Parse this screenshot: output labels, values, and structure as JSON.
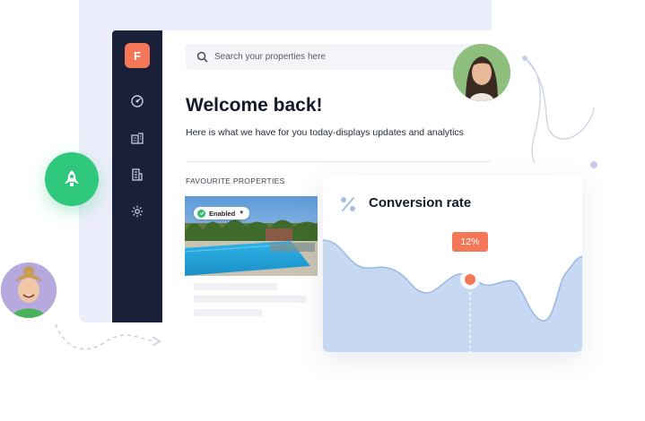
{
  "sidebar": {
    "logo_letter": "F",
    "items": [
      {
        "icon": "gauge-icon"
      },
      {
        "icon": "building-icon"
      },
      {
        "icon": "office-icon"
      },
      {
        "icon": "gear-icon"
      }
    ]
  },
  "search": {
    "placeholder": "Search your properties here"
  },
  "header": {
    "title": "Welcome back!",
    "subtitle": "Here is what we have for you today-displays updates and analytics"
  },
  "favourites": {
    "heading": "FAVOURITE PROPERTIES",
    "card": {
      "status": "Enabled"
    }
  },
  "conversion": {
    "title": "Conversion rate",
    "value_label": "12%"
  },
  "colors": {
    "accent": "#f47757",
    "sidebar": "#1a2037",
    "success": "#2fc87d",
    "chart_fill": "#c6d8f2",
    "chart_line": "#9dbbe5"
  }
}
